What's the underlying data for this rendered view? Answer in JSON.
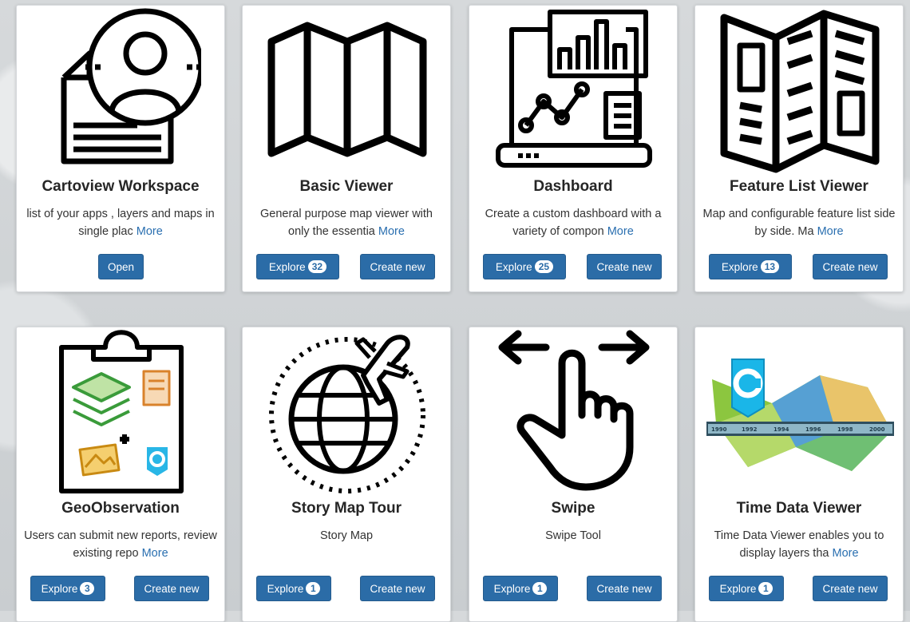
{
  "cards": [
    {
      "title": "Cartoview Workspace",
      "desc": "list of your apps , layers and maps in single plac",
      "more": "More",
      "open_label": "Open",
      "icon": "user-document-icon"
    },
    {
      "title": "Basic Viewer",
      "desc": "General purpose map viewer with only the essentia",
      "more": "More",
      "explore_label": "Explore",
      "explore_count": "32",
      "create_label": "Create new",
      "icon": "folded-map-icon"
    },
    {
      "title": "Dashboard",
      "desc": "Create a custom dashboard with a variety of compon",
      "more": "More",
      "explore_label": "Explore",
      "explore_count": "25",
      "create_label": "Create new",
      "icon": "laptop-dashboard-icon"
    },
    {
      "title": "Feature List Viewer",
      "desc": "Map and configurable feature list side by side. Ma",
      "more": "More",
      "explore_label": "Explore",
      "explore_count": "13",
      "create_label": "Create new",
      "icon": "brochure-list-icon"
    },
    {
      "title": "GeoObservation",
      "desc": "Users can submit new reports, review existing repo",
      "more": "More",
      "explore_label": "Explore",
      "explore_count": "3",
      "create_label": "Create new",
      "icon": "clipboard-layers-icon"
    },
    {
      "title": "Story Map Tour",
      "desc": "Story Map",
      "explore_label": "Explore",
      "explore_count": "1",
      "create_label": "Create new",
      "icon": "globe-plane-icon"
    },
    {
      "title": "Swipe",
      "desc": "Swipe Tool",
      "explore_label": "Explore",
      "explore_count": "1",
      "create_label": "Create new",
      "icon": "swipe-hand-icon"
    },
    {
      "title": "Time Data Viewer",
      "desc": "Time Data Viewer enables you to display layers tha",
      "more": "More",
      "explore_label": "Explore",
      "explore_count": "1",
      "create_label": "Create new",
      "icon": "timeline-map-icon",
      "timeline_years": [
        "1990",
        "1992",
        "1994",
        "1996",
        "1998",
        "2000"
      ]
    }
  ],
  "colors": {
    "button": "#2b6ca7",
    "link": "#2a6fb0"
  }
}
